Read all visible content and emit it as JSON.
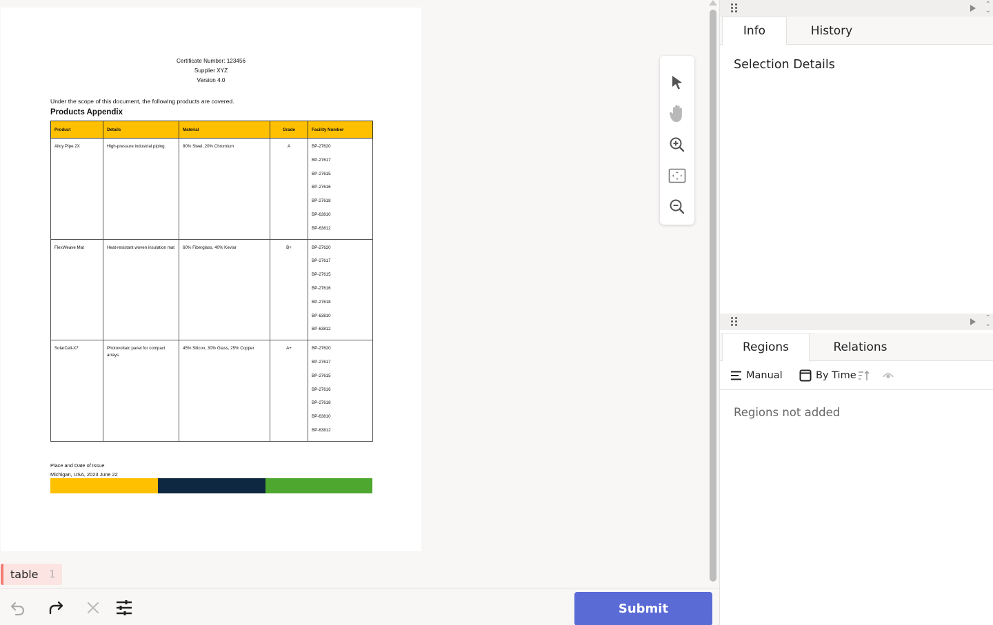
{
  "document": {
    "certificate_number": "Certificate Number: 123456",
    "supplier": "Supplier XYZ",
    "version": "Version 4.0",
    "scope_text": "Under the scope of this document, the following products are covered.",
    "appendix_title": "Products Appendix",
    "table": {
      "headers": [
        "Product",
        "Details",
        "Material",
        "Grade",
        "Facility Number"
      ],
      "rows": [
        {
          "product": "Alloy Pipe 2X",
          "details": "High-pressure industrial piping",
          "material": "80% Steel, 20% Chromium",
          "grade": "A",
          "facilities": [
            "BP-27620",
            "BP-27617",
            "BP-27615",
            "BP-27616",
            "BP-27618",
            "BP-63810",
            "BP-63812"
          ]
        },
        {
          "product": "FlexWeave Mat",
          "details": "Heat-resistant woven insulation mat",
          "material": "60% Fiberglass, 40% Kevlar",
          "grade": "B+",
          "facilities": [
            "BP-27620",
            "BP-27617",
            "BP-27615",
            "BP-27616",
            "BP-27618",
            "BP-63810",
            "BP-63812"
          ]
        },
        {
          "product": "SolarCell-X7",
          "details": "Photovoltaic panel for compact arrays",
          "material": "45% Silicon, 30% Glass, 25% Copper",
          "grade": "A+",
          "facilities": [
            "BP-27620",
            "BP-27617",
            "BP-27615",
            "BP-27616",
            "BP-27618",
            "BP-63810",
            "BP-63812"
          ]
        }
      ]
    },
    "issue_label": "Place and Date of Issue",
    "issue_value": "Michigan, USA, 2023 June 22",
    "bar_colors": [
      "#ffc000",
      "#0e2841",
      "#4ea72e"
    ],
    "header_color": "#ffc000"
  },
  "tools": [
    "select-arrow-icon",
    "pan-hand-icon",
    "zoom-in-icon",
    "fit-screen-icon",
    "zoom-out-icon"
  ],
  "region_chip": {
    "label": "table",
    "count": "1"
  },
  "toolbar": {
    "undo": "undo-icon",
    "redo": "redo-icon",
    "delete": "close-icon",
    "settings": "sliders-icon",
    "submit_label": "Submit",
    "submit_color": "#5b6bd6"
  },
  "panel": {
    "top_tabs": [
      "Info",
      "History"
    ],
    "selection_title": "Selection Details",
    "bottom_tabs": [
      "Regions",
      "Relations"
    ],
    "filters": {
      "manual": "Manual",
      "by_time": "By Time"
    },
    "empty_text": "Regions not added"
  }
}
